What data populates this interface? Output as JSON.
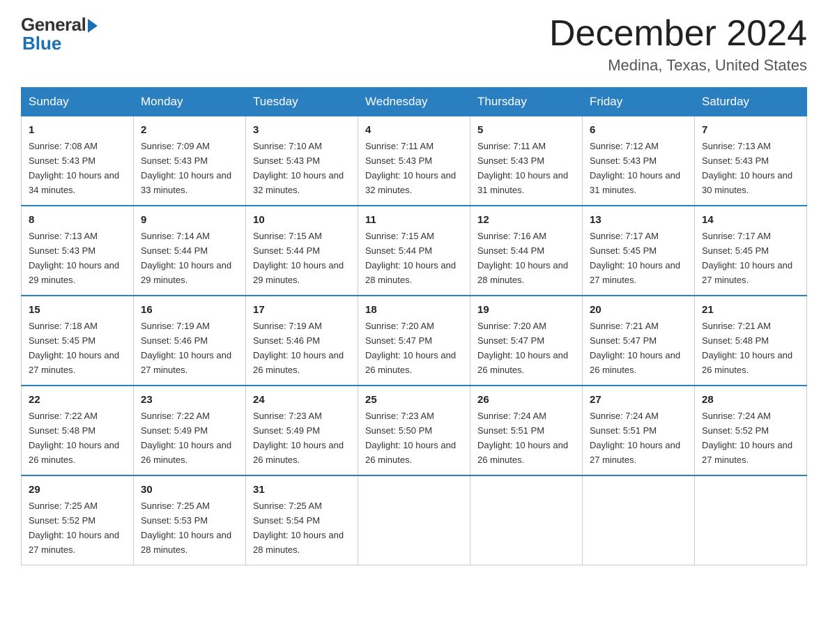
{
  "header": {
    "logo_general": "General",
    "logo_blue": "Blue",
    "month_title": "December 2024",
    "location": "Medina, Texas, United States"
  },
  "days_of_week": [
    "Sunday",
    "Monday",
    "Tuesday",
    "Wednesday",
    "Thursday",
    "Friday",
    "Saturday"
  ],
  "weeks": [
    [
      {
        "day": "1",
        "sunrise": "7:08 AM",
        "sunset": "5:43 PM",
        "daylight": "10 hours and 34 minutes."
      },
      {
        "day": "2",
        "sunrise": "7:09 AM",
        "sunset": "5:43 PM",
        "daylight": "10 hours and 33 minutes."
      },
      {
        "day": "3",
        "sunrise": "7:10 AM",
        "sunset": "5:43 PM",
        "daylight": "10 hours and 32 minutes."
      },
      {
        "day": "4",
        "sunrise": "7:11 AM",
        "sunset": "5:43 PM",
        "daylight": "10 hours and 32 minutes."
      },
      {
        "day": "5",
        "sunrise": "7:11 AM",
        "sunset": "5:43 PM",
        "daylight": "10 hours and 31 minutes."
      },
      {
        "day": "6",
        "sunrise": "7:12 AM",
        "sunset": "5:43 PM",
        "daylight": "10 hours and 31 minutes."
      },
      {
        "day": "7",
        "sunrise": "7:13 AM",
        "sunset": "5:43 PM",
        "daylight": "10 hours and 30 minutes."
      }
    ],
    [
      {
        "day": "8",
        "sunrise": "7:13 AM",
        "sunset": "5:43 PM",
        "daylight": "10 hours and 29 minutes."
      },
      {
        "day": "9",
        "sunrise": "7:14 AM",
        "sunset": "5:44 PM",
        "daylight": "10 hours and 29 minutes."
      },
      {
        "day": "10",
        "sunrise": "7:15 AM",
        "sunset": "5:44 PM",
        "daylight": "10 hours and 29 minutes."
      },
      {
        "day": "11",
        "sunrise": "7:15 AM",
        "sunset": "5:44 PM",
        "daylight": "10 hours and 28 minutes."
      },
      {
        "day": "12",
        "sunrise": "7:16 AM",
        "sunset": "5:44 PM",
        "daylight": "10 hours and 28 minutes."
      },
      {
        "day": "13",
        "sunrise": "7:17 AM",
        "sunset": "5:45 PM",
        "daylight": "10 hours and 27 minutes."
      },
      {
        "day": "14",
        "sunrise": "7:17 AM",
        "sunset": "5:45 PM",
        "daylight": "10 hours and 27 minutes."
      }
    ],
    [
      {
        "day": "15",
        "sunrise": "7:18 AM",
        "sunset": "5:45 PM",
        "daylight": "10 hours and 27 minutes."
      },
      {
        "day": "16",
        "sunrise": "7:19 AM",
        "sunset": "5:46 PM",
        "daylight": "10 hours and 27 minutes."
      },
      {
        "day": "17",
        "sunrise": "7:19 AM",
        "sunset": "5:46 PM",
        "daylight": "10 hours and 26 minutes."
      },
      {
        "day": "18",
        "sunrise": "7:20 AM",
        "sunset": "5:47 PM",
        "daylight": "10 hours and 26 minutes."
      },
      {
        "day": "19",
        "sunrise": "7:20 AM",
        "sunset": "5:47 PM",
        "daylight": "10 hours and 26 minutes."
      },
      {
        "day": "20",
        "sunrise": "7:21 AM",
        "sunset": "5:47 PM",
        "daylight": "10 hours and 26 minutes."
      },
      {
        "day": "21",
        "sunrise": "7:21 AM",
        "sunset": "5:48 PM",
        "daylight": "10 hours and 26 minutes."
      }
    ],
    [
      {
        "day": "22",
        "sunrise": "7:22 AM",
        "sunset": "5:48 PM",
        "daylight": "10 hours and 26 minutes."
      },
      {
        "day": "23",
        "sunrise": "7:22 AM",
        "sunset": "5:49 PM",
        "daylight": "10 hours and 26 minutes."
      },
      {
        "day": "24",
        "sunrise": "7:23 AM",
        "sunset": "5:49 PM",
        "daylight": "10 hours and 26 minutes."
      },
      {
        "day": "25",
        "sunrise": "7:23 AM",
        "sunset": "5:50 PM",
        "daylight": "10 hours and 26 minutes."
      },
      {
        "day": "26",
        "sunrise": "7:24 AM",
        "sunset": "5:51 PM",
        "daylight": "10 hours and 26 minutes."
      },
      {
        "day": "27",
        "sunrise": "7:24 AM",
        "sunset": "5:51 PM",
        "daylight": "10 hours and 27 minutes."
      },
      {
        "day": "28",
        "sunrise": "7:24 AM",
        "sunset": "5:52 PM",
        "daylight": "10 hours and 27 minutes."
      }
    ],
    [
      {
        "day": "29",
        "sunrise": "7:25 AM",
        "sunset": "5:52 PM",
        "daylight": "10 hours and 27 minutes."
      },
      {
        "day": "30",
        "sunrise": "7:25 AM",
        "sunset": "5:53 PM",
        "daylight": "10 hours and 28 minutes."
      },
      {
        "day": "31",
        "sunrise": "7:25 AM",
        "sunset": "5:54 PM",
        "daylight": "10 hours and 28 minutes."
      },
      null,
      null,
      null,
      null
    ]
  ]
}
